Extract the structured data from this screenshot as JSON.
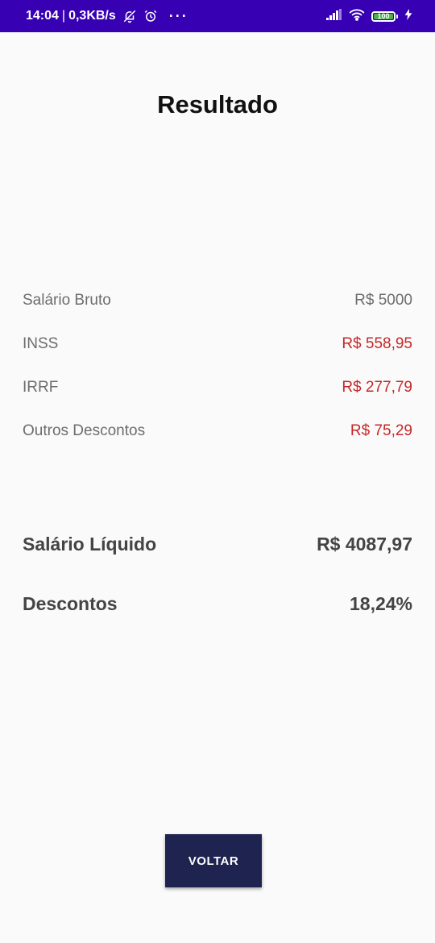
{
  "status_bar": {
    "time": "14:04",
    "separator": "|",
    "net_speed": "0,3KB/s",
    "icons": [
      "bell-off-icon",
      "alarm-icon",
      "more-dots-icon",
      "signal-icon",
      "wifi-icon",
      "battery-icon",
      "charging-icon"
    ],
    "dots": "···",
    "battery_level": "100",
    "background_color": "#3700b3"
  },
  "screen": {
    "title": "Resultado"
  },
  "breakdown": [
    {
      "label": "Salário Bruto",
      "value": "R$ 5000"
    },
    {
      "label": "INSS",
      "value": "R$ 558,95"
    },
    {
      "label": "IRRF",
      "value": "R$ 277,79"
    },
    {
      "label": "Outros Descontos",
      "value": "R$ 75,29"
    }
  ],
  "summary": {
    "net_salary_label": "Salário Líquido",
    "net_salary_value": "R$ 4087,97",
    "discounts_label": "Descontos",
    "discounts_value": "18,24%"
  },
  "actions": {
    "back_label": "VOLTAR"
  },
  "colors": {
    "negative_value": "#c62828",
    "button_background": "#1f2350",
    "screen_background": "#fafafa"
  }
}
